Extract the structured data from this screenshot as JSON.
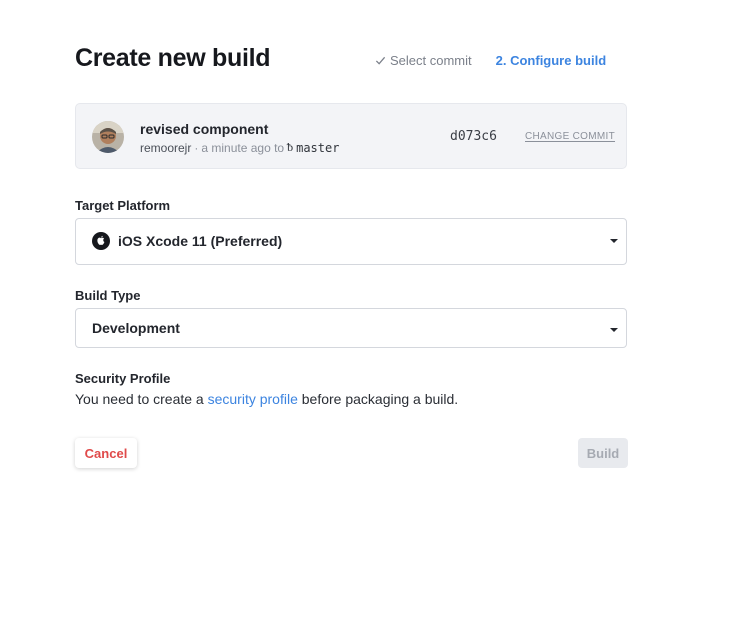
{
  "page_title": "Create new build",
  "steps": [
    {
      "label": "Select commit",
      "state": "done"
    },
    {
      "label": "2. Configure build",
      "state": "active"
    }
  ],
  "commit": {
    "message": "revised component",
    "author": "remoorejr",
    "separator": "·",
    "time": "a minute ago to",
    "branch_icon": "ᵬ",
    "branch": "master",
    "hash": "d073c6",
    "change_label": "CHANGE COMMIT"
  },
  "target_platform": {
    "label": "Target Platform",
    "value": "iOS Xcode 11 (Preferred)",
    "icon": "apple-icon"
  },
  "build_type": {
    "label": "Build Type",
    "value": "Development"
  },
  "security_profile": {
    "label": "Security Profile",
    "text_before": "You need to create a ",
    "link_text": "security profile",
    "text_after": " before packaging a build."
  },
  "buttons": {
    "cancel": "Cancel",
    "build": "Build"
  },
  "colors": {
    "accent": "#3c84e0",
    "danger": "#e04a4a",
    "disabled_bg": "#e8eaee"
  }
}
